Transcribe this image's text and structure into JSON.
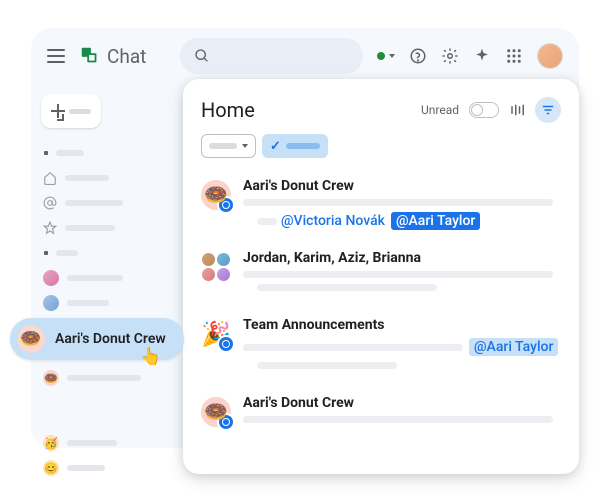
{
  "header": {
    "app_name": "Chat"
  },
  "card": {
    "title": "Home",
    "unread_label": "Unread"
  },
  "threads": [
    {
      "title": "Aari's Donut Crew",
      "mention1": "@Victoria Novák",
      "mention2": "@Aari Taylor"
    },
    {
      "title": "Jordan, Karim, Aziz, Brianna"
    },
    {
      "title": "Team Announcements",
      "mention": "@Aari Taylor"
    },
    {
      "title": "Aari's Donut Crew"
    }
  ],
  "hover": {
    "label": "Aari's Donut Crew"
  }
}
